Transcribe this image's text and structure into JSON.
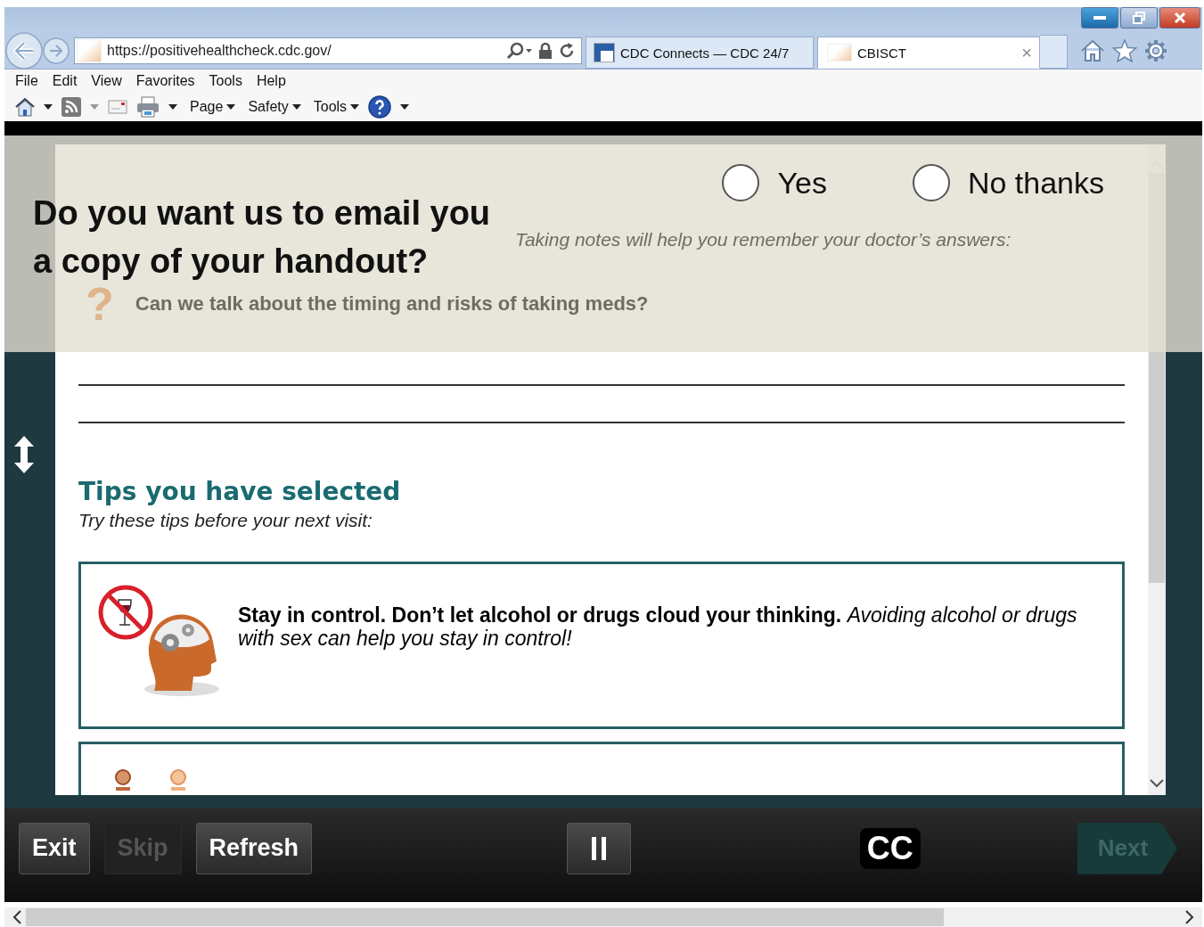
{
  "browser": {
    "address": "https://positivehealthcheck.cdc.gov/",
    "tabs": [
      {
        "label": "CDC Connects — CDC 24/7",
        "selected": false
      },
      {
        "label": "CBISCT",
        "selected": true,
        "close": "×"
      }
    ],
    "menu": [
      "File",
      "Edit",
      "View",
      "Favorites",
      "Tools",
      "Help"
    ],
    "command_bar": [
      "Page",
      "Safety",
      "Tools"
    ]
  },
  "page": {
    "intro": "Taking notes will help you remember your doctor’s answers:",
    "question_mark": "?",
    "question": "Can we talk about the timing and risks of taking meds?",
    "tips_heading": "Tips you have selected",
    "tips_subtitle": "Try these tips before your next visit:",
    "tips": [
      {
        "text": "**Stay in control. Don’t let alcohol or drugs cloud your thinking.** *Avoiding alcohol or drugs with sex can help you stay in control!*"
      }
    ]
  },
  "dialog": {
    "question": "Do you want us to email you a copy of your handout?",
    "options": [
      {
        "label": "Yes",
        "selected": false
      },
      {
        "label": "No thanks",
        "selected": false
      }
    ]
  },
  "controls": [
    {
      "label": "Exit",
      "disabled": false
    },
    {
      "label": "Skip",
      "disabled": true
    },
    {
      "label": "Refresh",
      "disabled": false
    }
  ],
  "captions": "CC",
  "next": {
    "label": "Next",
    "disabled": true
  }
}
